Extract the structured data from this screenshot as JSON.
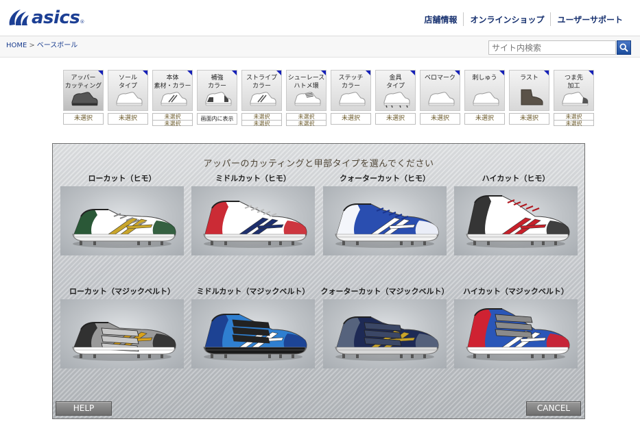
{
  "brand": {
    "logo_text": "asics",
    "registered_mark": "®",
    "brand_color": "#1c3f94"
  },
  "topnav": {
    "items": [
      "店舗情報",
      "オンラインショップ",
      "ユーザーサポート"
    ]
  },
  "breadcrumb": {
    "home": "HOME",
    "separator": ">",
    "current": "ベースボール"
  },
  "search": {
    "placeholder": "サイト内検索",
    "button_icon": "search-icon"
  },
  "steps": [
    {
      "label": "アッパー\nカッティング",
      "status": [
        "未選択"
      ],
      "active": true,
      "shoe": "low"
    },
    {
      "label": "ソール\nタイプ",
      "status": [
        "未選択"
      ],
      "shoe": "low-white"
    },
    {
      "label": "本体\n素材・カラー",
      "status": [
        "未選択",
        "未選択"
      ],
      "shoe": "stripe"
    },
    {
      "label": "補強\nカラー",
      "status": [
        "画面内に表示"
      ],
      "shoe": "reinforce"
    },
    {
      "label": "ストライプ\nカラー",
      "status": [
        "未選択",
        "未選択"
      ],
      "shoe": "stripe"
    },
    {
      "label": "シューレース\nハトメ環",
      "status": [
        "未選択",
        "未選択"
      ],
      "shoe": "lace"
    },
    {
      "label": "ステッチ\nカラー",
      "status": [
        "未選択"
      ],
      "shoe": "low-white"
    },
    {
      "label": "金具\nタイプ",
      "status": [
        "未選択"
      ],
      "shoe": "spike"
    },
    {
      "label": "ベロマーク",
      "status": [
        "未選択"
      ],
      "shoe": "low-white"
    },
    {
      "label": "刺しゅう",
      "status": [
        "未選択"
      ],
      "shoe": "low-white"
    },
    {
      "label": "ラスト",
      "status": [
        "未選択"
      ],
      "shoe": "last"
    },
    {
      "label": "つま先\n加工",
      "status": [
        "未選択",
        "未選択"
      ],
      "shoe": "toe"
    }
  ],
  "panel": {
    "title": "アッパーのカッティングと甲部タイプを選んでください",
    "options": [
      {
        "label": "ローカット（ヒモ）",
        "shoe": "low",
        "colors": {
          "upper": "#ffffff",
          "accent": "#1f4f2c",
          "stripe": "#c9a52a",
          "sole": "#f0f0f0",
          "trim": "#8a8a8a"
        }
      },
      {
        "label": "ミドルカット（ヒモ）",
        "shoe": "mid",
        "colors": {
          "upper": "#ffffff",
          "accent": "#c8202a",
          "stripe": "#1d2f6e",
          "sole": "#ececec",
          "trim": "#bcbcbc"
        }
      },
      {
        "label": "クォーターカット（ヒモ）",
        "shoe": "quarter",
        "colors": {
          "upper": "#2a4eb0",
          "accent": "#ffffff",
          "stripe": "#ffffff",
          "sole": "#f2f2f2",
          "trim": "#1a3590"
        }
      },
      {
        "label": "ハイカット（ヒモ）",
        "shoe": "high",
        "colors": {
          "upper": "#ffffff",
          "accent": "#2a2a2a",
          "stripe": "#c8202a",
          "sole": "#eeeeee",
          "trim": "#b01820"
        }
      },
      {
        "label": "ローカット（マジックベルト）",
        "shoe": "low-strap",
        "colors": {
          "upper": "#9a9a9a",
          "accent": "#2b2b2b",
          "stripe": "#d9a21c",
          "sole": "#ffffff",
          "trim": "#c8c8c8"
        }
      },
      {
        "label": "ミドルカット（マジックベルト）",
        "shoe": "mid-strap",
        "colors": {
          "upper": "#2f7fd0",
          "accent": "#1c3f8f",
          "stripe": "#ffffff",
          "sole": "#1a1a1a",
          "trim": "#222222"
        }
      },
      {
        "label": "クォーターカット（マジックベルト）",
        "shoe": "quarter-strap",
        "colors": {
          "upper": "#1e2a55",
          "accent": "#5a6680",
          "stripe": "#c8a32a",
          "sole": "#d8d8d8",
          "trim": "#3b4766"
        }
      },
      {
        "label": "ハイカット（マジックベルト）",
        "shoe": "high-strap",
        "colors": {
          "upper": "#2a56b8",
          "accent": "#d8202a",
          "stripe": "#ffffff",
          "sole": "#ffffff",
          "trim": "#8a8a8a"
        }
      }
    ],
    "help_label": "HELP",
    "cancel_label": "CANCEL"
  }
}
